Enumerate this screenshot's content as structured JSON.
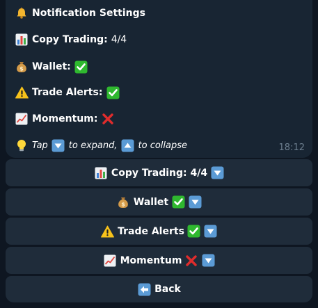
{
  "message": {
    "title": "Notification Settings",
    "copy_trading_label": "Copy Trading:",
    "copy_trading_value": "4/4",
    "wallet_label": "Wallet:",
    "trade_alerts_label": "Trade Alerts:",
    "momentum_label": "Momentum:",
    "hint_tap": "Tap",
    "hint_expand": "to expand,",
    "hint_collapse": "to collapse",
    "time": "18:12"
  },
  "keyboard": {
    "copy_trading": "Copy Trading: 4/4",
    "wallet": "Wallet",
    "trade_alerts": "Trade Alerts",
    "momentum": "Momentum",
    "back": "Back"
  },
  "icons": {
    "title": "bell-icon",
    "copy_trading": "bar-chart-icon",
    "wallet": "money-bag-icon",
    "trade_alerts": "warning-icon",
    "momentum": "chart-increasing-icon",
    "hint": "light-bulb-icon",
    "enabled": "check-mark-icon",
    "disabled": "cross-mark-icon",
    "expand": "down-arrow-icon",
    "collapse": "up-arrow-icon",
    "back": "left-arrow-icon"
  },
  "states": {
    "wallet": "enabled",
    "trade_alerts": "enabled",
    "momentum": "disabled"
  },
  "colors": {
    "background": "#0e1621",
    "bubble": "#182533",
    "button": "#1f2c3a",
    "check": "#2fb82f",
    "cross": "#e02c2c",
    "arrow_key": "#5b9bd5",
    "timestamp": "#6d7f8f"
  }
}
